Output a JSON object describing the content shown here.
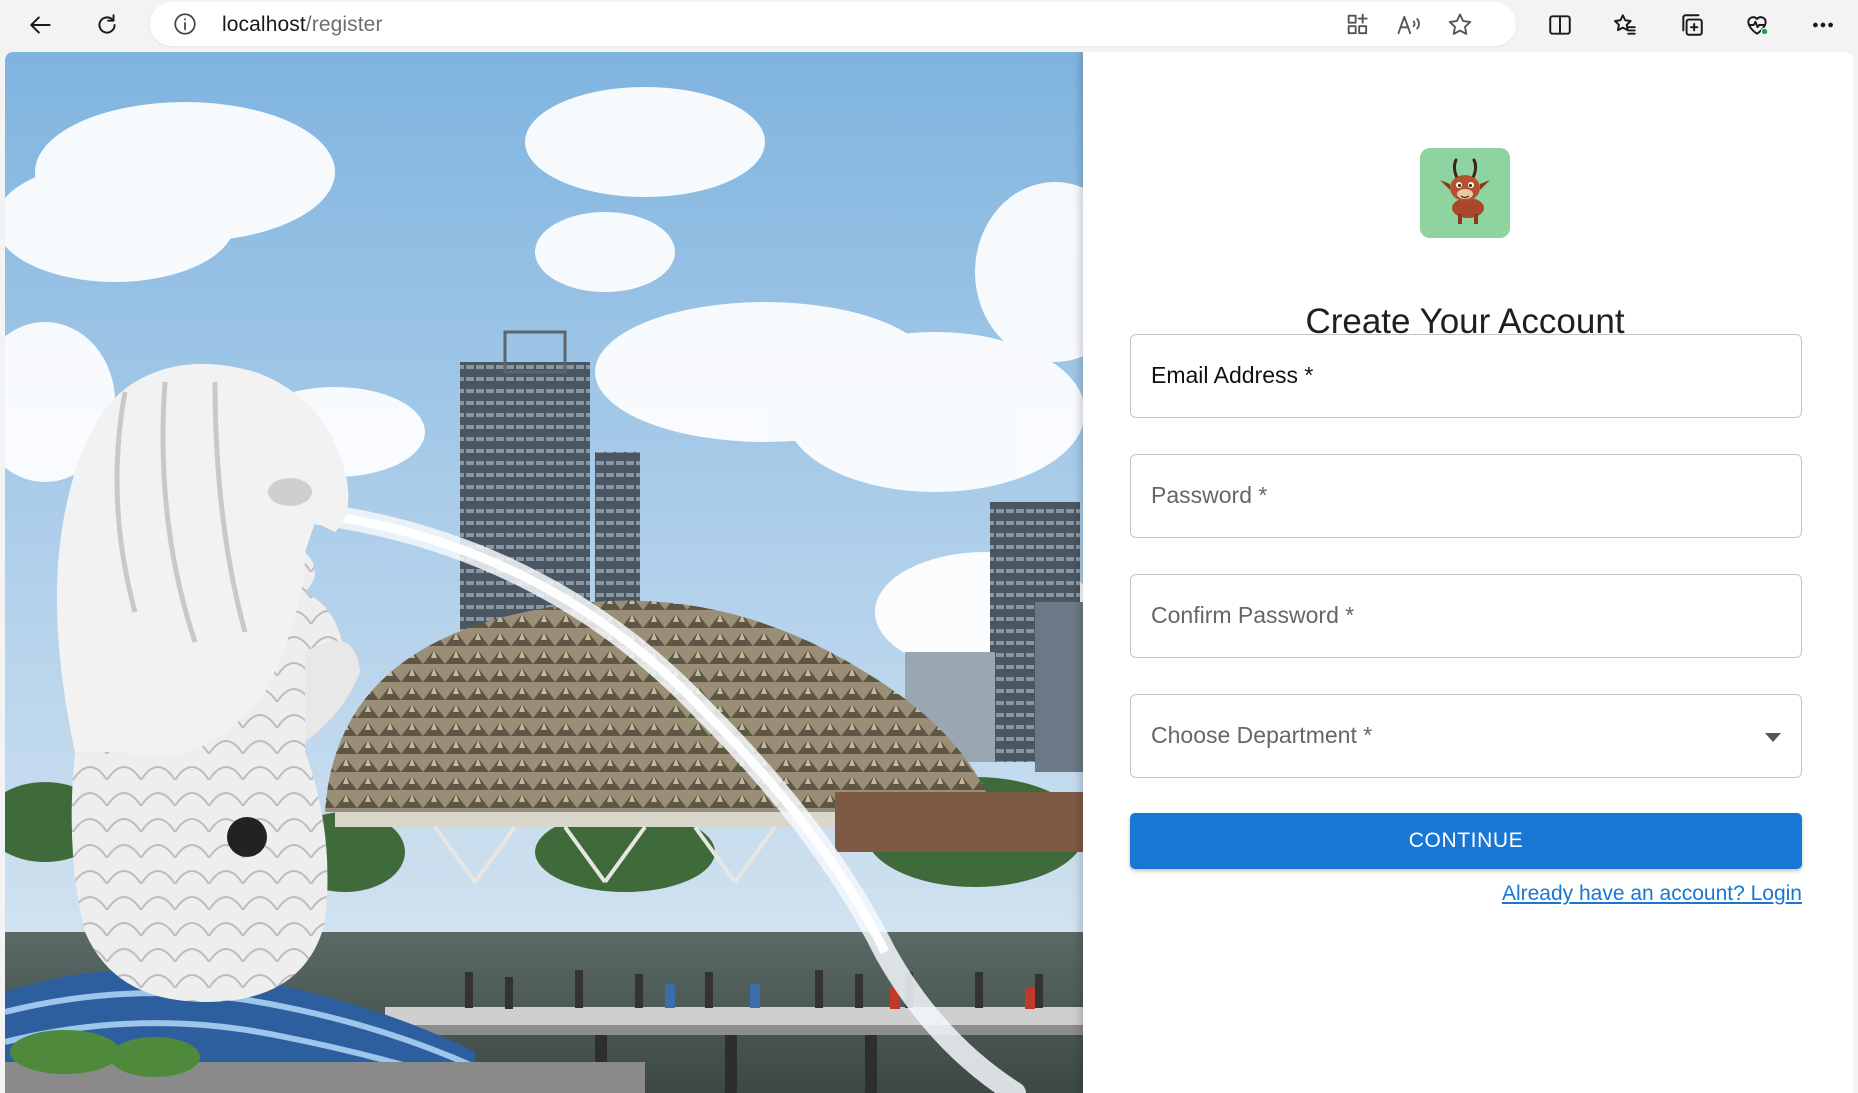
{
  "browser": {
    "url_host": "localhost",
    "url_path": "/register"
  },
  "icons": {
    "back": "back-arrow-icon",
    "refresh": "refresh-icon",
    "site_info": "info-icon",
    "apps": "app-available-icon",
    "read_aloud": "read-aloud-icon",
    "favorite": "star-icon",
    "split_screen": "split-screen-icon",
    "favorites": "favorites-icon",
    "collections": "collections-icon",
    "browser_essentials": "heart-pulse-icon",
    "more": "more-icon",
    "dropdown": "chevron-down-icon"
  },
  "form": {
    "title": "Create Your Account",
    "email_label": "Email Address *",
    "password_label": "Password *",
    "confirm_label": "Confirm Password *",
    "department_label": "Choose Department *",
    "continue_label": "CONTINUE",
    "login_link": "Already have an account? Login"
  },
  "colors": {
    "primary": "#1976d2",
    "logo_bg": "#8fd3a0"
  }
}
